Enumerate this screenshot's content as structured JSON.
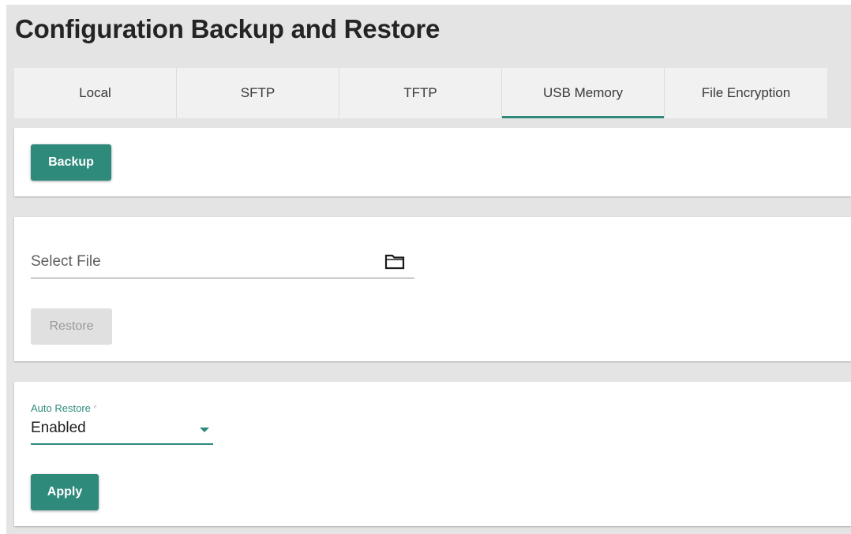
{
  "page": {
    "title": "Configuration Backup and Restore"
  },
  "tabs": [
    {
      "label": "Local",
      "active": false
    },
    {
      "label": "SFTP",
      "active": false
    },
    {
      "label": "TFTP",
      "active": false
    },
    {
      "label": "USB Memory",
      "active": true
    },
    {
      "label": "File Encryption",
      "active": false
    }
  ],
  "backup": {
    "button_label": "Backup"
  },
  "restore": {
    "file_placeholder": "Select File",
    "folder_icon": "folder-icon",
    "button_label": "Restore",
    "button_enabled": false
  },
  "auto_restore": {
    "label": "Auto Restore",
    "required_mark": "*",
    "selected_value": "Enabled",
    "apply_label": "Apply"
  },
  "colors": {
    "accent": "#2e8a7b",
    "page_background": "#e4e4e5",
    "disabled_button": "#e0e0e0"
  }
}
